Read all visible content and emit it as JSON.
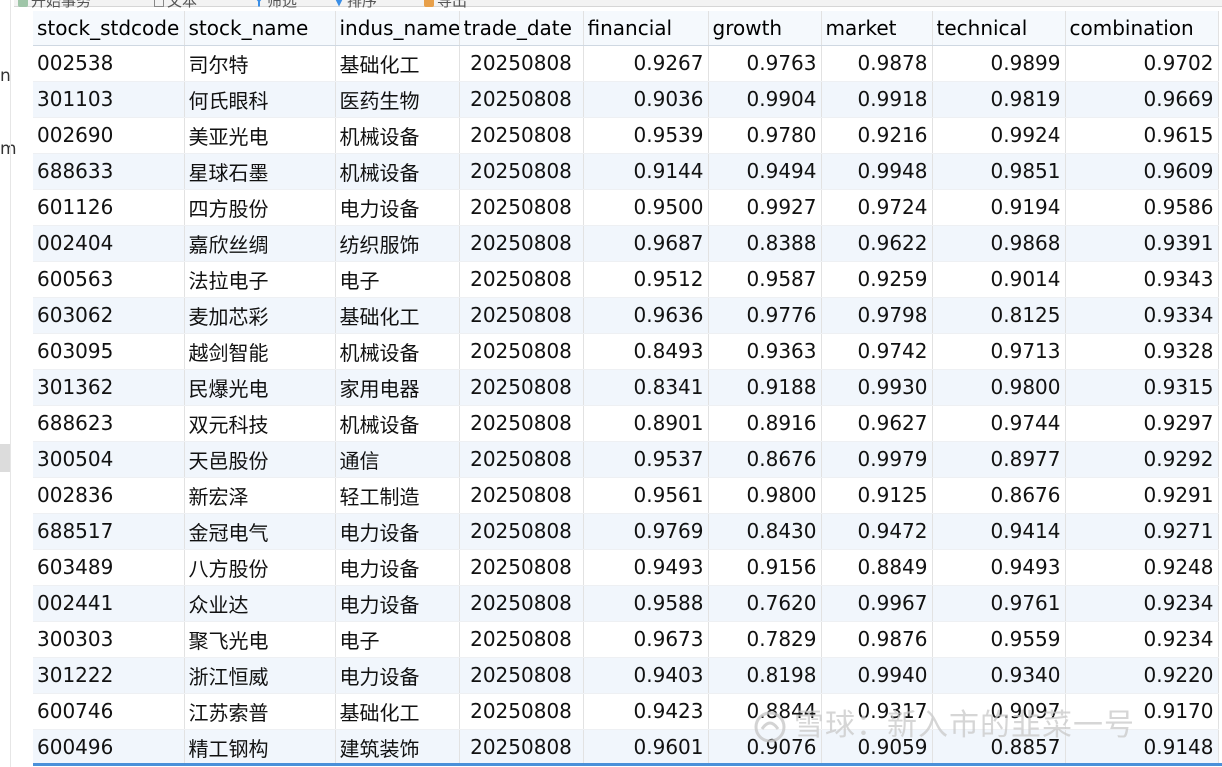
{
  "toolbar": {
    "items": [
      "开始事务",
      "文本",
      "筛选",
      "排序",
      "导出"
    ]
  },
  "left_panel": {
    "chars": [
      "n",
      "m"
    ]
  },
  "table": {
    "columns": [
      "stock_stdcode",
      "stock_name",
      "indus_name",
      "trade_date",
      "financial",
      "growth",
      "market",
      "technical",
      "combination"
    ],
    "rows": [
      [
        "002538",
        "司尔特",
        "基础化工",
        "20250808",
        "0.9267",
        "0.9763",
        "0.9878",
        "0.9899",
        "0.9702"
      ],
      [
        "301103",
        "何氏眼科",
        "医药生物",
        "20250808",
        "0.9036",
        "0.9904",
        "0.9918",
        "0.9819",
        "0.9669"
      ],
      [
        "002690",
        "美亚光电",
        "机械设备",
        "20250808",
        "0.9539",
        "0.9780",
        "0.9216",
        "0.9924",
        "0.9615"
      ],
      [
        "688633",
        "星球石墨",
        "机械设备",
        "20250808",
        "0.9144",
        "0.9494",
        "0.9948",
        "0.9851",
        "0.9609"
      ],
      [
        "601126",
        "四方股份",
        "电力设备",
        "20250808",
        "0.9500",
        "0.9927",
        "0.9724",
        "0.9194",
        "0.9586"
      ],
      [
        "002404",
        "嘉欣丝绸",
        "纺织服饰",
        "20250808",
        "0.9687",
        "0.8388",
        "0.9622",
        "0.9868",
        "0.9391"
      ],
      [
        "600563",
        "法拉电子",
        "电子",
        "20250808",
        "0.9512",
        "0.9587",
        "0.9259",
        "0.9014",
        "0.9343"
      ],
      [
        "603062",
        "麦加芯彩",
        "基础化工",
        "20250808",
        "0.9636",
        "0.9776",
        "0.9798",
        "0.8125",
        "0.9334"
      ],
      [
        "603095",
        "越剑智能",
        "机械设备",
        "20250808",
        "0.8493",
        "0.9363",
        "0.9742",
        "0.9713",
        "0.9328"
      ],
      [
        "301362",
        "民爆光电",
        "家用电器",
        "20250808",
        "0.8341",
        "0.9188",
        "0.9930",
        "0.9800",
        "0.9315"
      ],
      [
        "688623",
        "双元科技",
        "机械设备",
        "20250808",
        "0.8901",
        "0.8916",
        "0.9627",
        "0.9744",
        "0.9297"
      ],
      [
        "300504",
        "天邑股份",
        "通信",
        "20250808",
        "0.9537",
        "0.8676",
        "0.9979",
        "0.8977",
        "0.9292"
      ],
      [
        "002836",
        "新宏泽",
        "轻工制造",
        "20250808",
        "0.9561",
        "0.9800",
        "0.9125",
        "0.8676",
        "0.9291"
      ],
      [
        "688517",
        "金冠电气",
        "电力设备",
        "20250808",
        "0.9769",
        "0.8430",
        "0.9472",
        "0.9414",
        "0.9271"
      ],
      [
        "603489",
        "八方股份",
        "电力设备",
        "20250808",
        "0.9493",
        "0.9156",
        "0.8849",
        "0.9493",
        "0.9248"
      ],
      [
        "002441",
        "众业达",
        "电力设备",
        "20250808",
        "0.9588",
        "0.7620",
        "0.9967",
        "0.9761",
        "0.9234"
      ],
      [
        "300303",
        "聚飞光电",
        "电子",
        "20250808",
        "0.9673",
        "0.7829",
        "0.9876",
        "0.9559",
        "0.9234"
      ],
      [
        "301222",
        "浙江恒威",
        "电力设备",
        "20250808",
        "0.9403",
        "0.8198",
        "0.9940",
        "0.9340",
        "0.9220"
      ],
      [
        "600746",
        "江苏索普",
        "基础化工",
        "20250808",
        "0.9423",
        "0.8844",
        "0.9317",
        "0.9097",
        "0.9170"
      ],
      [
        "600496",
        "精工钢构",
        "建筑装饰",
        "20250808",
        "0.9601",
        "0.9076",
        "0.9059",
        "0.8857",
        "0.9148"
      ]
    ]
  },
  "watermark": {
    "text": "雪球：新入市的韭菜一号"
  },
  "colors": {
    "header_bg": "#f5f9fd",
    "row_alt": "#f1f6fc",
    "selection_line": "#4a90d9"
  }
}
